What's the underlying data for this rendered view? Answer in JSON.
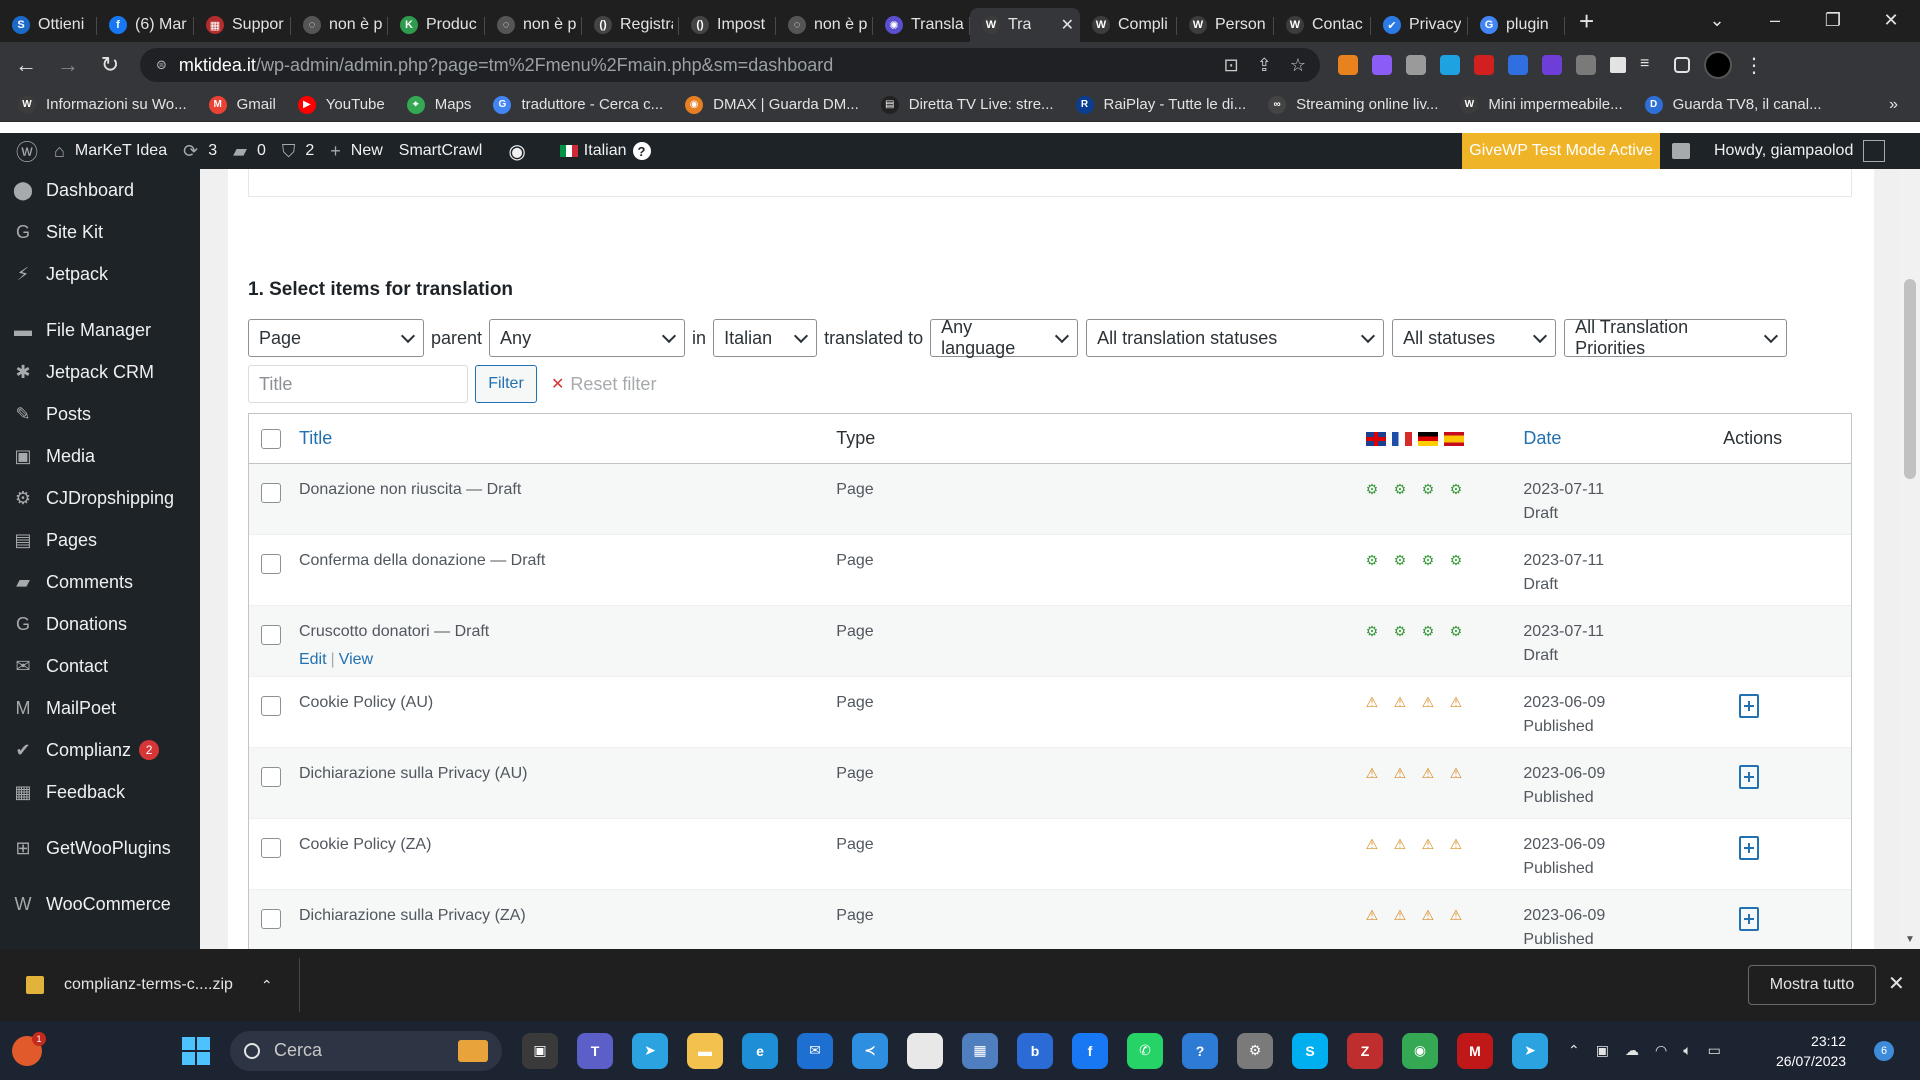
{
  "browser": {
    "tabs": [
      {
        "label": "Ottieni",
        "color": "#1b6ac9",
        "glyph": "S"
      },
      {
        "label": "(6) Mar",
        "color": "#1877f2",
        "glyph": "f"
      },
      {
        "label": "Suppor",
        "color": "#b32d2e",
        "glyph": "▦"
      },
      {
        "label": "non è p",
        "color": "#555555",
        "glyph": "◌"
      },
      {
        "label": "Produc",
        "color": "#2e9b4e",
        "glyph": "K"
      },
      {
        "label": "non è p",
        "color": "#555555",
        "glyph": "◌"
      },
      {
        "label": "Registra",
        "color": "#444444",
        "glyph": "()"
      },
      {
        "label": "Impost",
        "color": "#444444",
        "glyph": "()"
      },
      {
        "label": "non è p",
        "color": "#555555",
        "glyph": "◌"
      },
      {
        "label": "Translat",
        "color": "#5a4fcf",
        "glyph": "✺"
      },
      {
        "label": "Tra",
        "color": "#3c3c3c",
        "glyph": "W",
        "active": true
      },
      {
        "label": "Compli",
        "color": "#3c3c3c",
        "glyph": "W"
      },
      {
        "label": "Person",
        "color": "#3c3c3c",
        "glyph": "W"
      },
      {
        "label": "Contac",
        "color": "#3c3c3c",
        "glyph": "W"
      },
      {
        "label": "Privacy",
        "color": "#2c7be5",
        "glyph": "✔"
      },
      {
        "label": "plugin",
        "color": "#4285f4",
        "glyph": "G"
      }
    ],
    "new_tab_glyph": "+",
    "url_host": "mktidea.it",
    "url_path": "/wp-admin/admin.php?page=tm%2Fmenu%2Fmain.php&sm=dashboard",
    "bookmarks": [
      {
        "label": "Informazioni su Wo...",
        "color": "#3c3c3c",
        "glyph": "W"
      },
      {
        "label": "Gmail",
        "color": "#ea4335",
        "glyph": "M"
      },
      {
        "label": "YouTube",
        "color": "#ff0000",
        "glyph": "▶"
      },
      {
        "label": "Maps",
        "color": "#34a853",
        "glyph": "⌖"
      },
      {
        "label": "traduttore - Cerca c...",
        "color": "#4285f4",
        "glyph": "G"
      },
      {
        "label": "DMAX | Guarda DM...",
        "color": "#e67e22",
        "glyph": "◉"
      },
      {
        "label": "Diretta TV Live: stre...",
        "color": "#222222",
        "glyph": "▤"
      },
      {
        "label": "RaiPlay - Tutte le di...",
        "color": "#0b3d91",
        "glyph": "R"
      },
      {
        "label": "Streaming online liv...",
        "color": "#444444",
        "glyph": "∞"
      },
      {
        "label": "Mini impermeabile...",
        "color": "#3c3c3c",
        "glyph": "W"
      },
      {
        "label": "Guarda TV8, il canal...",
        "color": "#2e6fd8",
        "glyph": "D"
      }
    ],
    "bookmarks_more": "»"
  },
  "adminbar": {
    "site": "MarKeT Idea",
    "updates": "3",
    "comments": "0",
    "security": "2",
    "new": "New",
    "smartcrawl": "SmartCrawl",
    "language": "Italian",
    "givewp": "GiveWP Test Mode Active",
    "howdy": "Howdy, giampaolod"
  },
  "sidebar": [
    {
      "label": "Dashboard",
      "icon": "⬤"
    },
    {
      "label": "Site Kit",
      "icon": "G"
    },
    {
      "label": "Jetpack",
      "icon": "⚡"
    },
    {
      "label": "File Manager",
      "icon": "▬"
    },
    {
      "label": "Jetpack CRM",
      "icon": "✱"
    },
    {
      "label": "Posts",
      "icon": "✎"
    },
    {
      "label": "Media",
      "icon": "▣"
    },
    {
      "label": "CJDropshipping",
      "icon": "⚙"
    },
    {
      "label": "Pages",
      "icon": "▤"
    },
    {
      "label": "Comments",
      "icon": "▰"
    },
    {
      "label": "Donations",
      "icon": "G"
    },
    {
      "label": "Contact",
      "icon": "✉"
    },
    {
      "label": "MailPoet",
      "icon": "M"
    },
    {
      "label": "Complianz",
      "icon": "✔",
      "badge": "2"
    },
    {
      "label": "Feedback",
      "icon": "▦"
    },
    {
      "label": "GetWooPlugins",
      "icon": "⊞"
    },
    {
      "label": "WooCommerce",
      "icon": "W"
    }
  ],
  "main": {
    "section_title": "1. Select items for translation",
    "filters": {
      "type": "Page",
      "parent_label": "parent",
      "parent": "Any",
      "in_label": "in",
      "language": "Italian",
      "translated_to_label": "translated to",
      "target": "Any language",
      "translation_status": "All translation statuses",
      "status": "All statuses",
      "priority": "All Translation Priorities"
    },
    "title_placeholder": "Title",
    "filter_button": "Filter",
    "reset_filter": "Reset filter",
    "table": {
      "headers": {
        "title": "Title",
        "type": "Type",
        "date": "Date",
        "actions": "Actions"
      },
      "rows": [
        {
          "title": "Donazione non riuscita — Draft",
          "type": "Page",
          "date": "2023-07-11",
          "status": "Draft",
          "translated": true,
          "hover": false,
          "add_action": false
        },
        {
          "title": "Conferma della donazione — Draft",
          "type": "Page",
          "date": "2023-07-11",
          "status": "Draft",
          "translated": true,
          "hover": false,
          "add_action": false
        },
        {
          "title": "Cruscotto donatori — Draft",
          "type": "Page",
          "date": "2023-07-11",
          "status": "Draft",
          "translated": true,
          "hover": true,
          "add_action": false
        },
        {
          "title": "Cookie Policy (AU)",
          "type": "Page",
          "date": "2023-06-09",
          "status": "Published",
          "translated": false,
          "hover": false,
          "add_action": true
        },
        {
          "title": "Dichiarazione sulla Privacy (AU)",
          "type": "Page",
          "date": "2023-06-09",
          "status": "Published",
          "translated": false,
          "hover": false,
          "add_action": true
        },
        {
          "title": "Cookie Policy (ZA)",
          "type": "Page",
          "date": "2023-06-09",
          "status": "Published",
          "translated": false,
          "hover": false,
          "add_action": true
        },
        {
          "title": "Dichiarazione sulla Privacy (ZA)",
          "type": "Page",
          "date": "2023-06-09",
          "status": "Published",
          "translated": false,
          "hover": false,
          "add_action": true
        }
      ],
      "row_actions": {
        "edit": "Edit",
        "view": "View",
        "sep": "|"
      }
    }
  },
  "download": {
    "file": "complianz-terms-c....zip",
    "show_all": "Mostra tutto"
  },
  "taskbar": {
    "weather_badge": "1",
    "search_placeholder": "Cerca",
    "time": "23:12",
    "date": "26/07/2023",
    "notifications": "6",
    "apps": [
      {
        "name": "task-view",
        "color": "#3a3a3a",
        "glyph": "▣"
      },
      {
        "name": "teams",
        "color": "#5b5fc7",
        "glyph": "T"
      },
      {
        "name": "telegram",
        "color": "#2aa3e0",
        "glyph": "➤"
      },
      {
        "name": "explorer",
        "color": "#f2c14e",
        "glyph": "▬"
      },
      {
        "name": "edge",
        "color": "#1e8fd6",
        "glyph": "e"
      },
      {
        "name": "mail",
        "color": "#1d6fd1",
        "glyph": "✉"
      },
      {
        "name": "vscode",
        "color": "#2e8ee0",
        "glyph": "≺"
      },
      {
        "name": "notepad",
        "color": "#e8e8e8",
        "glyph": ""
      },
      {
        "name": "calculator",
        "color": "#4f7fbf",
        "glyph": "▦"
      },
      {
        "name": "bing",
        "color": "#2a6bd6",
        "glyph": "b"
      },
      {
        "name": "facebook",
        "color": "#1877f2",
        "glyph": "f"
      },
      {
        "name": "whatsapp",
        "color": "#25d366",
        "glyph": "✆"
      },
      {
        "name": "help",
        "color": "#2e7bd6",
        "glyph": "?"
      },
      {
        "name": "settings",
        "color": "#7a7a7a",
        "glyph": "⚙"
      },
      {
        "name": "skype",
        "color": "#00aff0",
        "glyph": "S"
      },
      {
        "name": "filezilla",
        "color": "#bf2e2e",
        "glyph": "Z"
      },
      {
        "name": "chrome",
        "color": "#34a853",
        "glyph": "◉"
      },
      {
        "name": "mcafee",
        "color": "#c01818",
        "glyph": "M"
      },
      {
        "name": "telegram-2",
        "color": "#2aa3e0",
        "glyph": "➤"
      }
    ]
  },
  "colors": {
    "wp_blue": "#2271b1",
    "admin_bg": "#1d2327",
    "givewp": "#f0b429"
  }
}
